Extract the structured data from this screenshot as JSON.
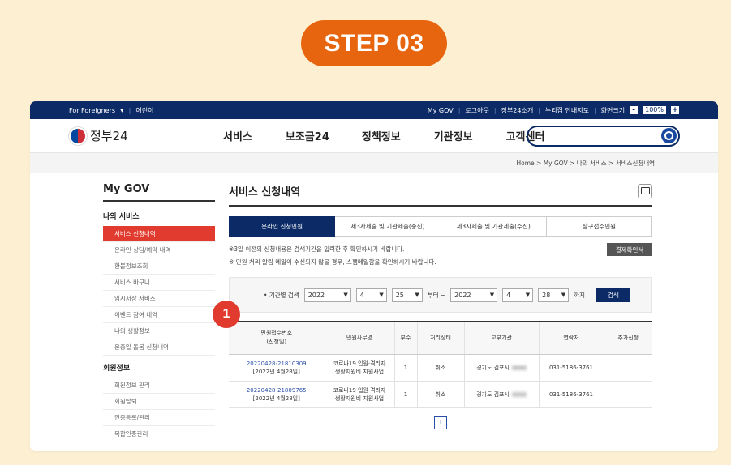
{
  "step_label": "STEP 03",
  "marker_number": "1",
  "utility": {
    "foreigners": "For Foreigners",
    "kids": "어린이",
    "mygov": "My GOV",
    "logout": "로그아웃",
    "intro": "정부24소개",
    "sitemap": "누리집 안내지도",
    "zoom_label": "화면크기",
    "zoom_minus": "-",
    "zoom_value": "100%",
    "zoom_plus": "+"
  },
  "header": {
    "logo_text": "정부24",
    "nav": [
      "서비스",
      "보조금24",
      "정책정보",
      "기관정보",
      "고객센터"
    ]
  },
  "breadcrumb": "Home > My GOV > 나의 서비스 > 서비스신청내역",
  "sidebar": {
    "title": "My GOV",
    "section1": "나의 서비스",
    "items1": [
      "서비스 신청내역",
      "온라인 상담/예약 내역",
      "환불정보조회",
      "서비스 바구니",
      "임시저장 서비스",
      "이벤트 참여 내역",
      "나의 생활정보",
      "온종일 돌봄 신청내역"
    ],
    "section2": "회원정보",
    "items2": [
      "회원정보 관리",
      "회원탈퇴",
      "인증등록/관리",
      "복합인증관리"
    ]
  },
  "main": {
    "title": "서비스 신청내역",
    "tabs": [
      "온라인 신청민원",
      "제3자제출 및 기관제출(송신)",
      "제3자제출 및 기관제출(수신)",
      "장구접수민원"
    ],
    "notice1": "※3일 이전의 신청내용은 검색기간을 입력한 후 확인하시기 바랍니다.",
    "notice2": "※ 민원 처리 알림 메일이 수신되지 않을 경우, 스팸메일함을 확인하시기 바랍니다.",
    "confirm_button": "결제확인서",
    "search": {
      "label": "• 기간별 검색",
      "from_year": "2022",
      "from_month": "4",
      "from_day": "25",
      "from_suffix": "부터 ~",
      "to_year": "2022",
      "to_month": "4",
      "to_day": "28",
      "to_suffix": "까지",
      "button": "검색"
    },
    "table": {
      "headers": [
        "민원접수번호\n(신청일)",
        "민원사무명",
        "부수",
        "처리상태",
        "교부기관",
        "연락처",
        "추가신청"
      ],
      "rows": [
        {
          "receipt": "20220428-21810309",
          "date": "[2022년 4월28일]",
          "name1": "코로나19 입원·격리자",
          "name2": "생활지원비 지원사업",
          "count": "1",
          "status": "취소",
          "agency": "경기도 김포시",
          "contact": "031-5186-3761",
          "extra": ""
        },
        {
          "receipt": "20220428-21809765",
          "date": "[2022년 4월28일]",
          "name1": "코로나19 입원·격리자",
          "name2": "생활지원비 지원사업",
          "count": "1",
          "status": "취소",
          "agency": "경기도 김포시",
          "contact": "031-5186-3761",
          "extra": ""
        }
      ]
    },
    "page": "1"
  }
}
